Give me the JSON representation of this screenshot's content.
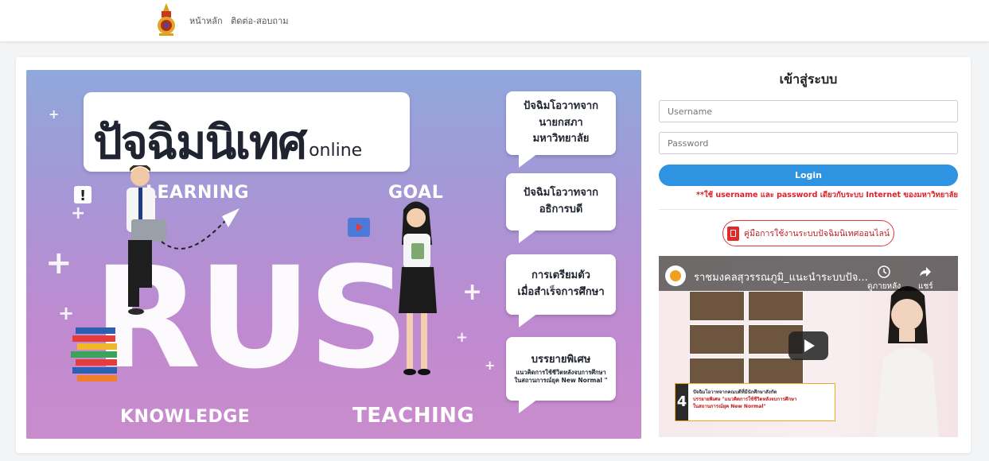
{
  "nav": {
    "home": "หน้าหลัก",
    "contact": "ติดต่อ-สอบถาม"
  },
  "banner": {
    "title_big": "ปัจฉิมนิเทศ",
    "title_small": "online",
    "word_learning": "LEARNING",
    "word_goal": "GOAL",
    "word_knowledge": "KNOWLEDGE",
    "word_teaching": "TEACHING",
    "word_rus": "RUS",
    "bubbles": [
      {
        "line1": "ปัจฉิมโอวาทจาก",
        "line2": "นายกสภามหาวิทยาลัย"
      },
      {
        "line1": "ปัจฉิมโอวาทจาก",
        "line2": "อธิการบดี"
      },
      {
        "line1": "การเตรียมตัว",
        "line2": "เมื่อสำเร็จการศึกษา"
      },
      {
        "line1": "บรรยายพิเศษ",
        "line2": "แนวคิดการใช้ชีวิตหลังจบการศึกษา",
        "line3": "ในสถานการณ์ยุค New Normal \""
      }
    ]
  },
  "login": {
    "title": "เข้าสู่ระบบ",
    "username_placeholder": "Username",
    "password_placeholder": "Password",
    "button": "Login",
    "note": "**ใช้ username และ password เดียวกับระบบ Internet ของมหาวิทยาลัย",
    "manual_button": "คู่มือการใช้งานระบบปัจฉิมนิเทศออนไลน์"
  },
  "video": {
    "title": "ราชมงคลสุวรรณภูมิ_แนะนำระบบปัจ...",
    "watch_later": "ดูภายหลัง",
    "share": "แชร์",
    "caption_number": "4",
    "caption_line1": "ปัจฉิมโอวาทจากคณบดีที่มีนักศึกษาสังกัด",
    "caption_line2": "บรรยายพิเศษ \"แนวคิดการใช้ชีวิตหลังจบการศึกษา",
    "caption_line3": "ในสถานการณ์ยุค New Normal\""
  },
  "colors": {
    "accent": "#2e93e0",
    "alert": "#e0202a",
    "banner_top": "#8fa8dc",
    "banner_bottom": "#c98ccc"
  }
}
